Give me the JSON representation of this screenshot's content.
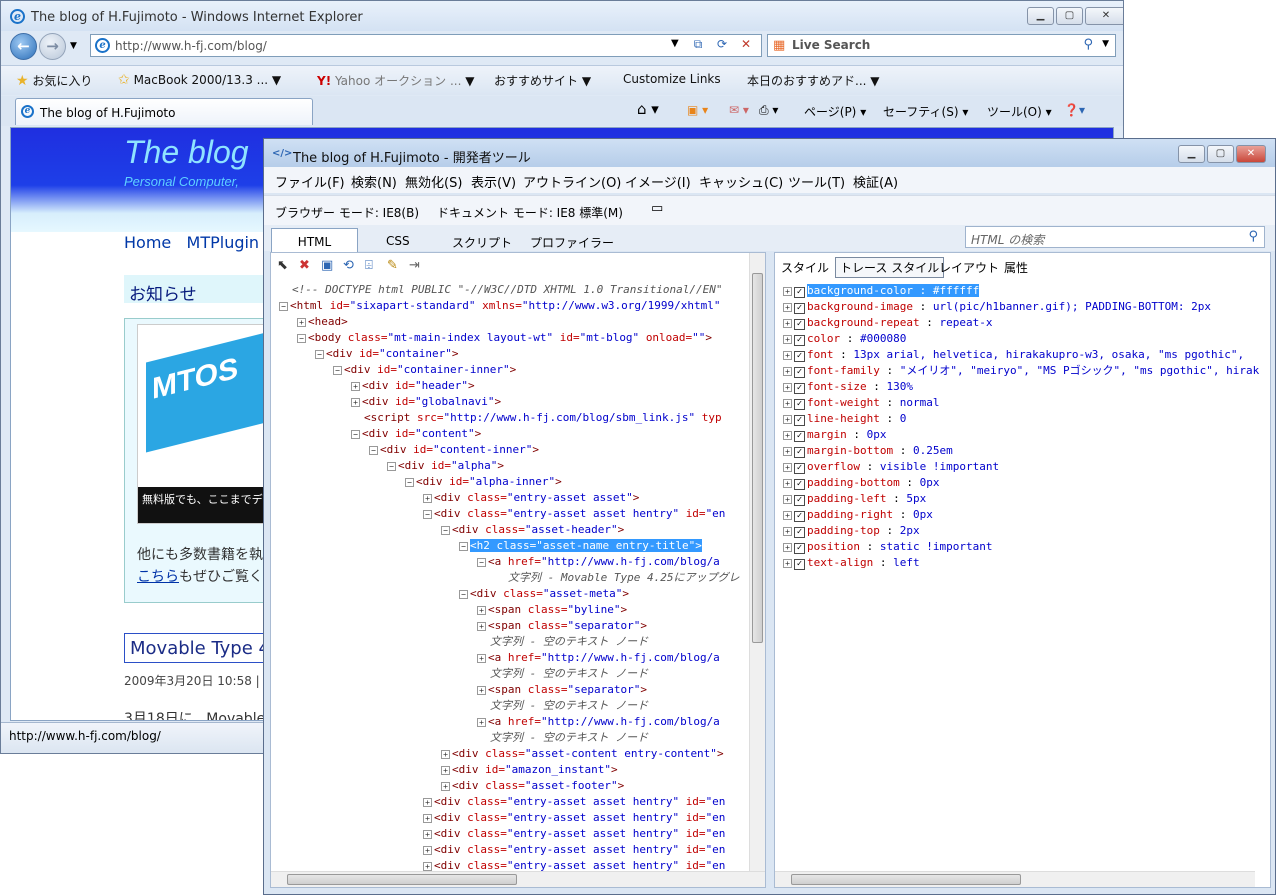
{
  "ie": {
    "title": "The blog of H.Fujimoto - Windows Internet Explorer",
    "back_icon": "back-arrow-icon",
    "address": "http://www.h-fj.com/blog/",
    "search_label": "Live Search",
    "favorites": [
      "お気に入り",
      "MacBook 2000/13.3 ...",
      "Yahoo オークション ...",
      "おすすめサイト",
      "Customize Links",
      "本日のおすすめアド..."
    ],
    "tab_title": "The blog of H.Fujimoto",
    "commands": [
      "ページ(P)",
      "セーフティ(S)",
      "ツール(O)"
    ],
    "status_url": "http://www.h-fj.com/blog/"
  },
  "page": {
    "blog_title": "The blog",
    "blog_subtitle": "Personal Computer,",
    "nav": [
      "Home",
      "MTPlugin"
    ],
    "notice": "お知らせ",
    "book_line1": "他にも多数書籍を執",
    "book_link": "こちら",
    "book_line2": "もぜひご覧く",
    "book_cover_text": "MTOS",
    "book_banner": "無料版でも、ここまでデ",
    "post_title": "Movable Type 4",
    "post_meta": "2009年3月20日 10:58 | 1",
    "post_body": "3月18日に、Movable"
  },
  "devtools": {
    "title": "The blog of H.Fujimoto - 開発者ツール",
    "menu": [
      "ファイル(F)",
      "検索(N)",
      "無効化(S)",
      "表示(V)",
      "アウトライン(O)",
      "イメージ(I)",
      "キャッシュ(C)",
      "ツール(T)",
      "検証(A)"
    ],
    "browser_mode": "ブラウザー モード: IE8(B)",
    "doc_mode": "ドキュメント モード: IE8 標準(M)",
    "tabs": [
      "HTML",
      "CSS",
      "スクリプト",
      "プロファイラー"
    ],
    "search_placeholder": "HTML の検索",
    "right_tabs": [
      "スタイル",
      "トレース スタイル",
      "レイアウト",
      "属性"
    ],
    "tree": [
      {
        "d": 0,
        "pm": "",
        "html": "<span class='cm'>&lt;!-- DOCTYPE html PUBLIC \"-//W3C//DTD XHTML 1.0 Transitional//EN\"</span>"
      },
      {
        "d": 0,
        "pm": "-",
        "html": "<span class='tg'>&lt;html</span> <span class='an'>id=</span><span class='av'>\"sixapart-standard\"</span> <span class='an'>xmlns=</span><span class='av'>\"http://www.w3.org/1999/xhtml\"</span>"
      },
      {
        "d": 1,
        "pm": "+",
        "html": "<span class='tg'>&lt;head&gt;</span>"
      },
      {
        "d": 1,
        "pm": "-",
        "html": "<span class='tg'>&lt;body</span> <span class='an'>class=</span><span class='av'>\"mt-main-index layout-wt\"</span> <span class='an'>id=</span><span class='av'>\"mt-blog\"</span> <span class='an'>onload=</span><span class='av'>\"\"</span><span class='tg'>&gt;</span>"
      },
      {
        "d": 2,
        "pm": "-",
        "html": "<span class='tg'>&lt;div</span> <span class='an'>id=</span><span class='av'>\"container\"</span><span class='tg'>&gt;</span>"
      },
      {
        "d": 3,
        "pm": "-",
        "html": "<span class='tg'>&lt;div</span> <span class='an'>id=</span><span class='av'>\"container-inner\"</span><span class='tg'>&gt;</span>"
      },
      {
        "d": 4,
        "pm": "+",
        "html": "<span class='tg'>&lt;div</span> <span class='an'>id=</span><span class='av'>\"header\"</span><span class='tg'>&gt;</span>"
      },
      {
        "d": 4,
        "pm": "+",
        "html": "<span class='tg'>&lt;div</span> <span class='an'>id=</span><span class='av'>\"globalnavi\"</span><span class='tg'>&gt;</span>"
      },
      {
        "d": 4,
        "pm": " ",
        "html": "<span class='tg'>&lt;script</span> <span class='an'>src=</span><span class='av'>\"http://www.h-fj.com/blog/sbm_link.js\"</span> <span class='an'>typ</span>"
      },
      {
        "d": 4,
        "pm": "-",
        "html": "<span class='tg'>&lt;div</span> <span class='an'>id=</span><span class='av'>\"content\"</span><span class='tg'>&gt;</span>"
      },
      {
        "d": 5,
        "pm": "-",
        "html": "<span class='tg'>&lt;div</span> <span class='an'>id=</span><span class='av'>\"content-inner\"</span><span class='tg'>&gt;</span>"
      },
      {
        "d": 6,
        "pm": "-",
        "html": "<span class='tg'>&lt;div</span> <span class='an'>id=</span><span class='av'>\"alpha\"</span><span class='tg'>&gt;</span>"
      },
      {
        "d": 7,
        "pm": "-",
        "html": "<span class='tg'>&lt;div</span> <span class='an'>id=</span><span class='av'>\"alpha-inner\"</span><span class='tg'>&gt;</span>"
      },
      {
        "d": 8,
        "pm": "+",
        "html": "<span class='tg'>&lt;div</span> <span class='an'>class=</span><span class='av'>\"entry-asset asset\"</span><span class='tg'>&gt;</span>"
      },
      {
        "d": 8,
        "pm": "-",
        "html": "<span class='tg'>&lt;div</span> <span class='an'>class=</span><span class='av'>\"entry-asset asset hentry\"</span> <span class='an'>id=</span><span class='av'>\"en</span>"
      },
      {
        "d": 9,
        "pm": "-",
        "html": "<span class='tg'>&lt;div</span> <span class='an'>class=</span><span class='av'>\"asset-header\"</span><span class='tg'>&gt;</span>"
      },
      {
        "d": 10,
        "pm": "-",
        "sel": true,
        "html": "<span class='tg'>&lt;h2</span> <span class='an'>class=</span><span class='av'>\"asset-name entry-title\"</span><span class='tg'>&gt;</span>"
      },
      {
        "d": 11,
        "pm": "-",
        "html": "<span class='tg'>&lt;a</span> <span class='an'>href=</span><span class='av'>\"http://www.h-fj.com/blog/a</span>"
      },
      {
        "d": 12,
        "pm": " ",
        "html": "<span class='tx'>文字列 - Movable Type 4.25にアップグレ</span>"
      },
      {
        "d": 10,
        "pm": "-",
        "html": "<span class='tg'>&lt;div</span> <span class='an'>class=</span><span class='av'>\"asset-meta\"</span><span class='tg'>&gt;</span>"
      },
      {
        "d": 11,
        "pm": "+",
        "html": "<span class='tg'>&lt;span</span> <span class='an'>class=</span><span class='av'>\"byline\"</span><span class='tg'>&gt;</span>"
      },
      {
        "d": 11,
        "pm": "+",
        "html": "<span class='tg'>&lt;span</span> <span class='an'>class=</span><span class='av'>\"separator\"</span><span class='tg'>&gt;</span>"
      },
      {
        "d": 11,
        "pm": " ",
        "html": "<span class='tx'>文字列 - 空のテキスト ノード</span>"
      },
      {
        "d": 11,
        "pm": "+",
        "html": "<span class='tg'>&lt;a</span> <span class='an'>href=</span><span class='av'>\"http://www.h-fj.com/blog/a</span>"
      },
      {
        "d": 11,
        "pm": " ",
        "html": "<span class='tx'>文字列 - 空のテキスト ノード</span>"
      },
      {
        "d": 11,
        "pm": "+",
        "html": "<span class='tg'>&lt;span</span> <span class='an'>class=</span><span class='av'>\"separator\"</span><span class='tg'>&gt;</span>"
      },
      {
        "d": 11,
        "pm": " ",
        "html": "<span class='tx'>文字列 - 空のテキスト ノード</span>"
      },
      {
        "d": 11,
        "pm": "+",
        "html": "<span class='tg'>&lt;a</span> <span class='an'>href=</span><span class='av'>\"http://www.h-fj.com/blog/a</span>"
      },
      {
        "d": 11,
        "pm": " ",
        "html": "<span class='tx'>文字列 - 空のテキスト ノード</span>"
      },
      {
        "d": 9,
        "pm": "+",
        "html": "<span class='tg'>&lt;div</span> <span class='an'>class=</span><span class='av'>\"asset-content entry-content\"</span><span class='tg'>&gt;</span>"
      },
      {
        "d": 9,
        "pm": "+",
        "html": "<span class='tg'>&lt;div</span> <span class='an'>id=</span><span class='av'>\"amazon_instant\"</span><span class='tg'>&gt;</span>"
      },
      {
        "d": 9,
        "pm": "+",
        "html": "<span class='tg'>&lt;div</span> <span class='an'>class=</span><span class='av'>\"asset-footer\"</span><span class='tg'>&gt;</span>"
      },
      {
        "d": 8,
        "pm": "+",
        "html": "<span class='tg'>&lt;div</span> <span class='an'>class=</span><span class='av'>\"entry-asset asset hentry\"</span> <span class='an'>id=</span><span class='av'>\"en</span>"
      },
      {
        "d": 8,
        "pm": "+",
        "html": "<span class='tg'>&lt;div</span> <span class='an'>class=</span><span class='av'>\"entry-asset asset hentry\"</span> <span class='an'>id=</span><span class='av'>\"en</span>"
      },
      {
        "d": 8,
        "pm": "+",
        "html": "<span class='tg'>&lt;div</span> <span class='an'>class=</span><span class='av'>\"entry-asset asset hentry\"</span> <span class='an'>id=</span><span class='av'>\"en</span>"
      },
      {
        "d": 8,
        "pm": "+",
        "html": "<span class='tg'>&lt;div</span> <span class='an'>class=</span><span class='av'>\"entry-asset asset hentry\"</span> <span class='an'>id=</span><span class='av'>\"en</span>"
      },
      {
        "d": 8,
        "pm": "+",
        "html": "<span class='tg'>&lt;div</span> <span class='an'>class=</span><span class='av'>\"entry-asset asset hentry\"</span> <span class='an'>id=</span><span class='av'>\"en</span>"
      }
    ],
    "styles": [
      [
        "background-color",
        "#ffffff"
      ],
      [
        "background-image",
        "url(pic/h1banner.gif); PADDING-BOTTOM: 2px"
      ],
      [
        "background-repeat",
        "repeat-x"
      ],
      [
        "color",
        "#000080"
      ],
      [
        "font",
        "13px arial, helvetica, hirakakupro-w3, osaka, \"ms pgothic\","
      ],
      [
        "font-family",
        "\"メイリオ\", \"meiryo\", \"MS Pゴシック\", \"ms pgothic\", hirak"
      ],
      [
        "font-size",
        "130%"
      ],
      [
        "font-weight",
        "normal"
      ],
      [
        "line-height",
        "0"
      ],
      [
        "margin",
        "0px"
      ],
      [
        "margin-bottom",
        "0.25em"
      ],
      [
        "overflow",
        "visible !important"
      ],
      [
        "padding-bottom",
        "0px"
      ],
      [
        "padding-left",
        "5px"
      ],
      [
        "padding-right",
        "0px"
      ],
      [
        "padding-top",
        "2px"
      ],
      [
        "position",
        "static !important"
      ],
      [
        "text-align",
        "left"
      ]
    ]
  }
}
